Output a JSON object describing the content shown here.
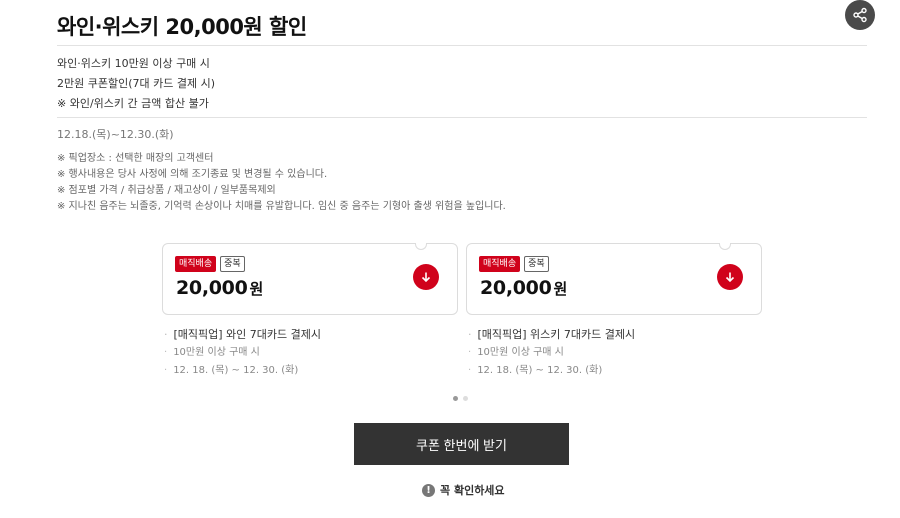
{
  "page": {
    "title": "와인·위스키 20,000원 할인",
    "description": [
      "와인·위스키 10만원 이상 구매 시",
      "2만원 쿠폰할인(7대 카드 결제 시)",
      "※ 와인/위스키 간 금액 합산 불가"
    ],
    "period": "12.18.(목)~12.30.(화)",
    "notes": [
      "※ 픽업장소 : 선택한 매장의 고객센터",
      "※ 행사내용은 당사 사정에 의해 조기종료 및 변경될 수 있습니다.",
      "※ 점포별 가격 / 취급상품 / 재고상이 / 일부품목제외",
      "※ 지나친 음주는 뇌졸중, 기억력 손상이나 치매를 유발합니다. 임신 중 음주는 기형아 출생 위험을 높입니다."
    ]
  },
  "coupons": [
    {
      "badge_delivery": "매직배송",
      "badge_dup": "중복",
      "amount": "20,000",
      "unit": "원",
      "name": "[매직픽업] 와인 7대카드 결제시",
      "condition": "10만원 이상 구매 시",
      "period": "12. 18. (목) ~ 12. 30. (화)"
    },
    {
      "badge_delivery": "매직배송",
      "badge_dup": "중복",
      "amount": "20,000",
      "unit": "원",
      "name": "[매직픽업] 위스키 7대카드 결제시",
      "condition": "10만원 이상 구매 시",
      "period": "12. 18. (목) ~ 12. 30. (화)"
    }
  ],
  "carousel": {
    "pages": 2,
    "active": 0
  },
  "cta": {
    "label": "쿠폰 한번에 받기"
  },
  "notice": {
    "icon": "!",
    "label": "꼭 확인하세요"
  },
  "icons": {
    "share": "share-icon",
    "download": "download-arrow-icon",
    "notice": "exclamation-icon"
  },
  "colors": {
    "accent": "#d0021b",
    "cta": "#333333"
  }
}
